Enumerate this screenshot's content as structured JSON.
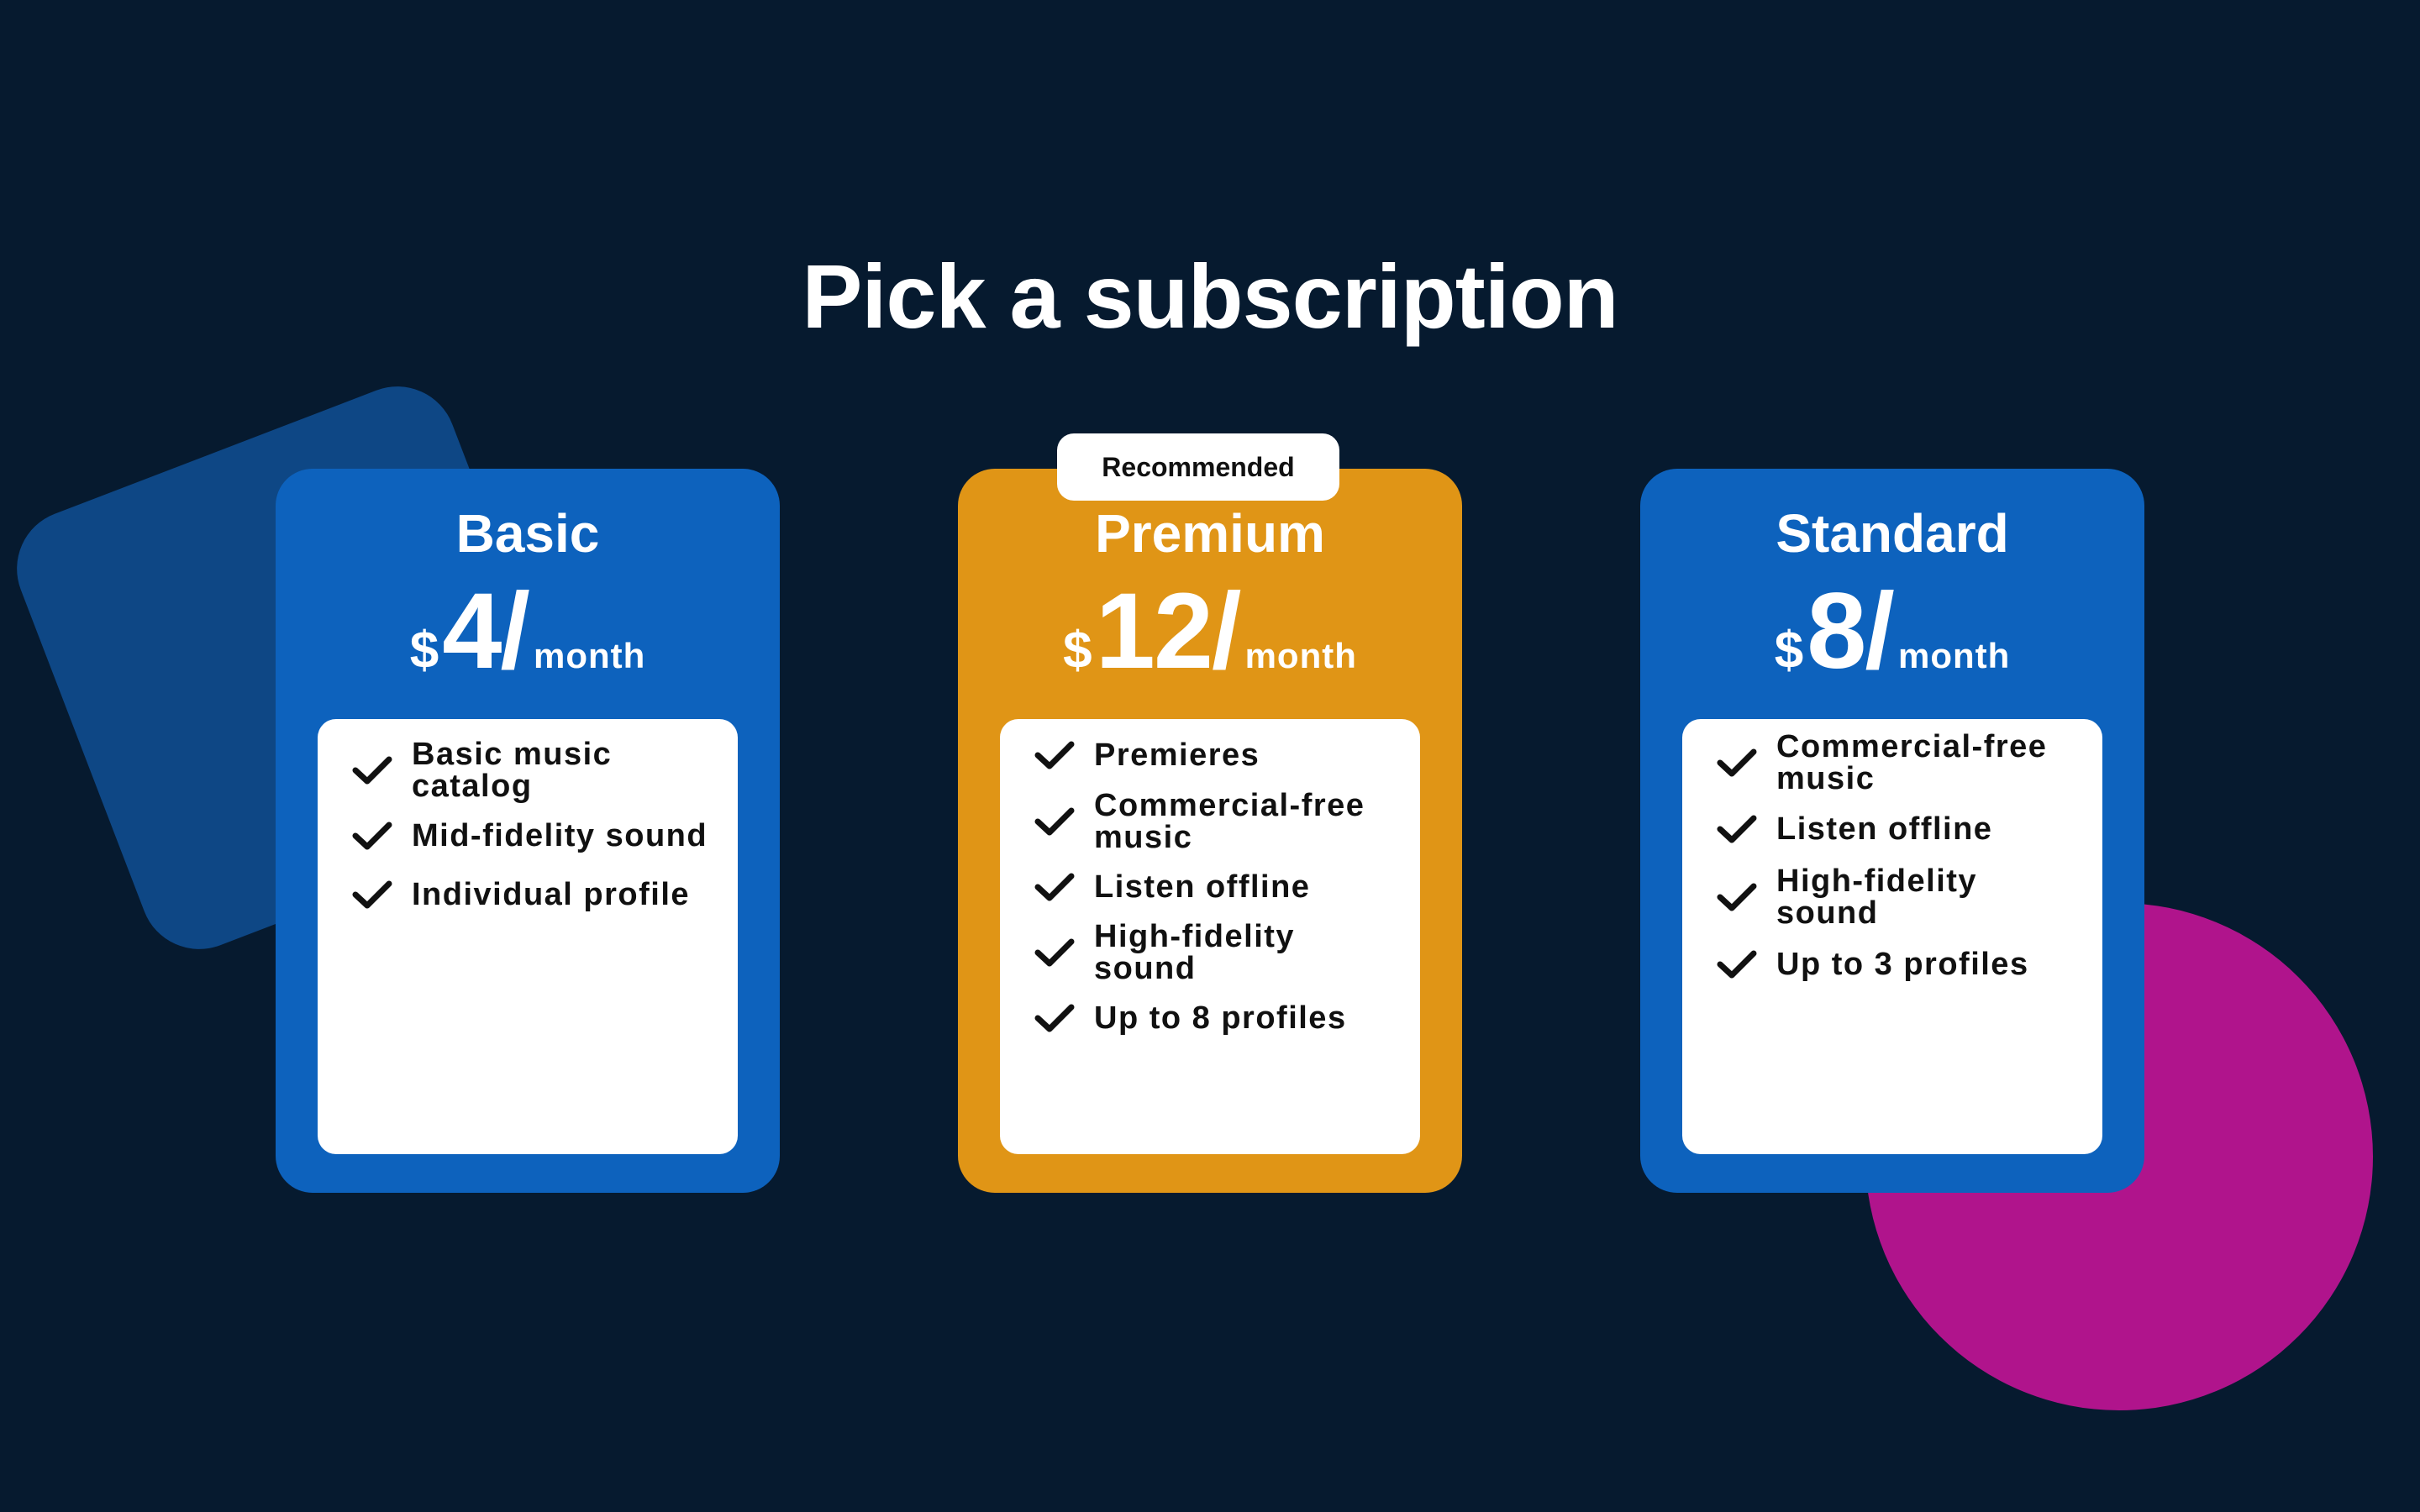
{
  "title": "Pick a subscription",
  "colors": {
    "background": "#061a2f",
    "card_blue": "#0d62bd",
    "card_gold": "#e09516",
    "deco_square": "#0e4785",
    "deco_circle": "#b0148c"
  },
  "badge": "Recommended",
  "plans": [
    {
      "name": "Basic",
      "currency": "$",
      "amount": "4/",
      "period": "month",
      "features": [
        "Basic music catalog",
        "Mid-fidelity sound",
        "Individual profile"
      ]
    },
    {
      "name": "Premium",
      "currency": "$",
      "amount": "12/",
      "period": "month",
      "features": [
        "Premieres",
        "Commercial-free music",
        "Listen offline",
        "High-fidelity sound",
        "Up to 8 profiles"
      ]
    },
    {
      "name": "Standard",
      "currency": "$",
      "amount": "8/",
      "period": "month",
      "features": [
        "Commercial-free music",
        "Listen offline",
        "High-fidelity sound",
        "Up to 3 profiles"
      ]
    }
  ],
  "icons": {
    "feature": "checkmark-icon"
  }
}
